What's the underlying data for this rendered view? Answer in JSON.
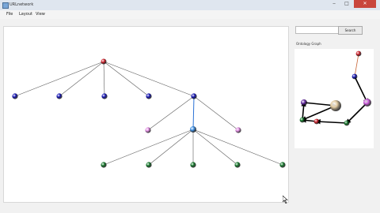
{
  "window": {
    "title": "URLnetwork",
    "minimize_glyph": "‒",
    "maximize_glyph": "□",
    "close_glyph": "✕"
  },
  "menu": {
    "items": [
      "File",
      "Layout",
      "View"
    ]
  },
  "colors": {
    "root": "#d11f2a",
    "blue": "#1414b8",
    "pink": "#e28be4",
    "lightblue": "#3f92e8",
    "green": "#137a2a",
    "edge": "#5a5a5a",
    "edge_selected": "#2c73d6",
    "mini_edge": "#000000",
    "mini_top_edge": "#c8683a",
    "tan": "#e3cba1",
    "purple": "#6b2fa8",
    "magenta": "#d061e0"
  },
  "graph": {
    "nodes": [
      {
        "id": "root",
        "label": "",
        "color": "root",
        "label_color": "root"
      },
      {
        "id": "b1",
        "label": "",
        "color": "blue",
        "label_color": "blue"
      },
      {
        "id": "b2",
        "label": "",
        "color": "blue",
        "label_color": "blue"
      },
      {
        "id": "b3",
        "label": "",
        "color": "blue",
        "label_color": "blue"
      },
      {
        "id": "b4",
        "label": "",
        "color": "blue",
        "label_color": "blue"
      },
      {
        "id": "b5",
        "label": "",
        "color": "blue",
        "label_color": "blue"
      },
      {
        "id": "p1",
        "label": "",
        "color": "pink",
        "label_color": "pink"
      },
      {
        "id": "lb",
        "label": "",
        "color": "lightblue",
        "label_color": "lightblue"
      },
      {
        "id": "p2",
        "label": "",
        "color": "pink",
        "label_color": "pink"
      },
      {
        "id": "g1",
        "label": "",
        "color": "green",
        "label_color": "green"
      },
      {
        "id": "g2",
        "label": "",
        "color": "green",
        "label_color": "green"
      },
      {
        "id": "g3",
        "label": "",
        "color": "green",
        "label_color": "green"
      },
      {
        "id": "g4",
        "label": "",
        "color": "green",
        "label_color": "green"
      },
      {
        "id": "g5",
        "label": "",
        "color": "green",
        "label_color": "green"
      }
    ],
    "edges": [
      [
        "root",
        "b1"
      ],
      [
        "root",
        "b2"
      ],
      [
        "root",
        "b3"
      ],
      [
        "root",
        "b4"
      ],
      [
        "root",
        "b5"
      ],
      [
        "b5",
        "p1"
      ],
      [
        "b5",
        "lb"
      ],
      [
        "b5",
        "p2"
      ],
      [
        "lb",
        "g1"
      ],
      [
        "lb",
        "g2"
      ],
      [
        "lb",
        "g3"
      ],
      [
        "lb",
        "g4"
      ],
      [
        "lb",
        "g5"
      ]
    ],
    "selected_edge": [
      "b5",
      "lb"
    ]
  },
  "sidebar": {
    "search_placeholder": "",
    "search_label": "Search",
    "ontology_label": "Ontology Graph"
  },
  "ontology": {
    "nodes": [
      {
        "id": "top",
        "label": "",
        "color": "root"
      },
      {
        "id": "mid",
        "label": "",
        "color": "blue"
      },
      {
        "id": "mag",
        "label": "",
        "color": "magenta"
      },
      {
        "id": "tan",
        "label": "",
        "color": "tan"
      },
      {
        "id": "pur",
        "label": "",
        "color": "purple"
      },
      {
        "id": "gr1",
        "label": "",
        "color": "green"
      },
      {
        "id": "red",
        "label": "",
        "color": "root"
      },
      {
        "id": "gr2",
        "label": "",
        "color": "green"
      }
    ],
    "edges": [
      [
        "top",
        "mid"
      ],
      [
        "mid",
        "mag"
      ],
      [
        "mag",
        "gr2"
      ],
      [
        "gr2",
        "red"
      ],
      [
        "red",
        "gr1"
      ],
      [
        "gr1",
        "pur"
      ],
      [
        "pur",
        "tan"
      ],
      [
        "tan",
        "gr1"
      ]
    ]
  }
}
